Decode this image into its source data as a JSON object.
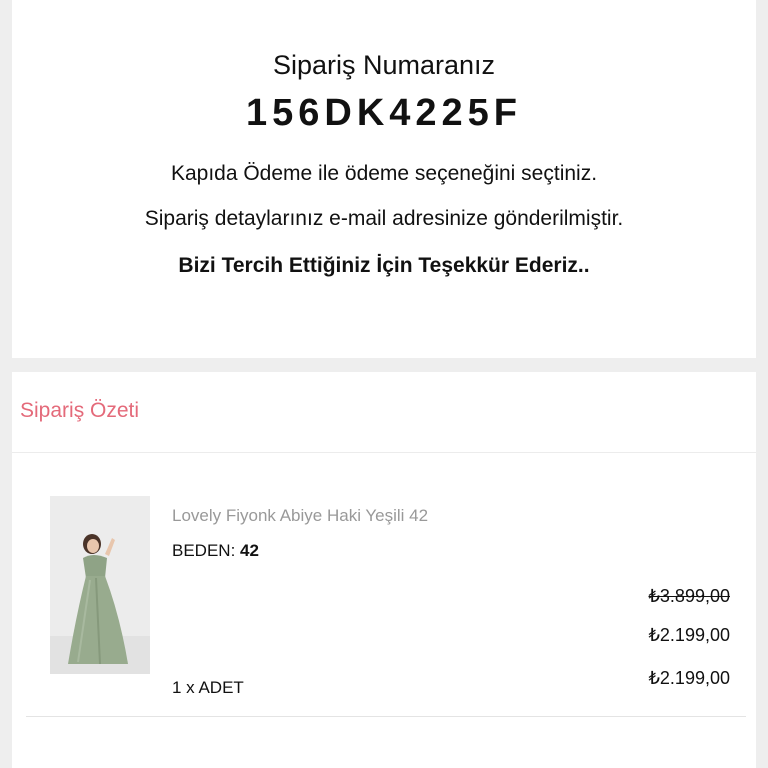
{
  "confirmation": {
    "order_label": "Sipariş Numaranız",
    "order_number": "156DK4225F",
    "payment_message": "Kapıda Ödeme ile ödeme seçeneğini seçtiniz.",
    "email_message": "Sipariş detaylarınız e-mail adresinize gönderilmiştir.",
    "thanks_message": "Bizi Tercih Ettiğiniz İçin Teşekkür Ederiz.."
  },
  "summary": {
    "title": "Sipariş Özeti",
    "accent_color": "#e46a7a",
    "item": {
      "name": "Lovely Fiyonk Abiye Haki Yeşili 42",
      "size_label": "BEDEN:",
      "size_value": "42",
      "quantity": "1 x ADET",
      "old_price": "₺3.899,00",
      "price": "₺2.199,00",
      "total": "₺2.199,00",
      "image_icon": "product-dress-photo"
    }
  }
}
